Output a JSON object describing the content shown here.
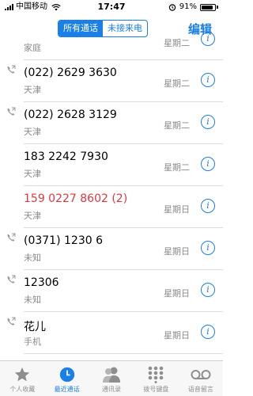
{
  "status": {
    "carrier": "中国移动",
    "time": "17:47",
    "battery_pct": "91%",
    "battery_level": 0.91
  },
  "nav": {
    "segments": [
      {
        "label": "所有通话",
        "active": true
      },
      {
        "label": "未接来电",
        "active": false
      }
    ],
    "edit_label": "编辑"
  },
  "calls": [
    {
      "name": "",
      "sub": "家庭",
      "day": "星期二",
      "outgoing": false,
      "missed": false,
      "partial": true
    },
    {
      "name": "(022) 2629 3630",
      "sub": "天津",
      "day": "星期二",
      "outgoing": true,
      "missed": false
    },
    {
      "name": "(022) 2628 3129",
      "sub": "天津",
      "day": "星期二",
      "outgoing": true,
      "missed": false
    },
    {
      "name": "183 2242 7930",
      "sub": "天津",
      "day": "星期二",
      "outgoing": false,
      "missed": false
    },
    {
      "name": "159 0227 8602 (2)",
      "sub": "天津",
      "day": "星期日",
      "outgoing": false,
      "missed": true
    },
    {
      "name": "(0371) 1230 6",
      "sub": "未知",
      "day": "星期日",
      "outgoing": true,
      "missed": false
    },
    {
      "name": "12306",
      "sub": "未知",
      "day": "星期日",
      "outgoing": true,
      "missed": false
    },
    {
      "name": "花儿",
      "sub": "手机",
      "day": "星期日",
      "outgoing": true,
      "missed": false
    }
  ],
  "tabs": [
    {
      "label": "个人收藏",
      "icon": "star-icon",
      "active": false
    },
    {
      "label": "最近通话",
      "icon": "clock-icon",
      "active": true
    },
    {
      "label": "通讯录",
      "icon": "contacts-icon",
      "active": false
    },
    {
      "label": "拨号键盘",
      "icon": "keypad-icon",
      "active": false
    },
    {
      "label": "语音留言",
      "icon": "voicemail-icon",
      "active": false
    }
  ],
  "colors": {
    "accent": "#1a7fe6",
    "missed": "#e0373e",
    "secondary": "#8a8a8a"
  }
}
